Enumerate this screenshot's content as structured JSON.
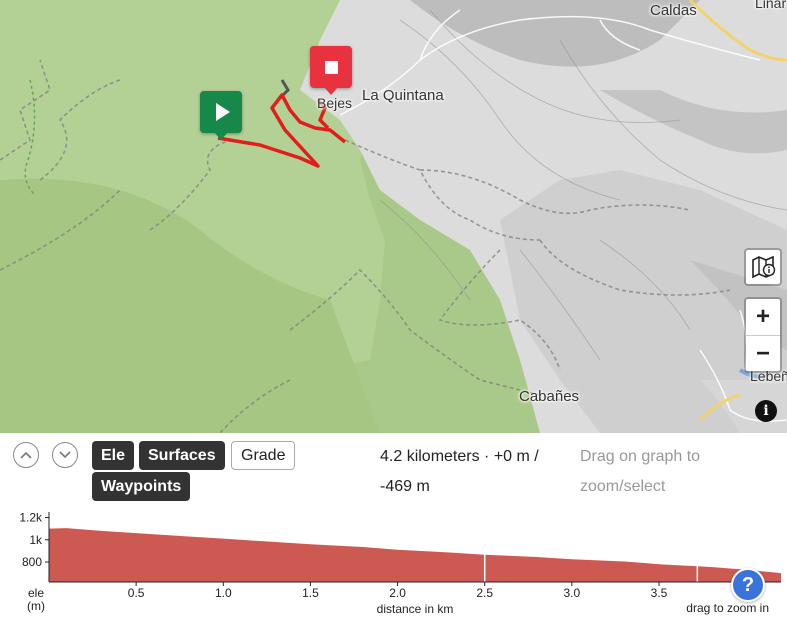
{
  "map": {
    "places": [
      {
        "name": "Caldas"
      },
      {
        "name": "Linar"
      },
      {
        "name": "Bejes"
      },
      {
        "name": "La Quintana"
      },
      {
        "name": "Cabañes"
      },
      {
        "name": "Lebeñ"
      }
    ],
    "markers": {
      "start": "play-icon",
      "end": "stop-icon"
    },
    "controls": {
      "layers_icon": "map-layers-icon",
      "zoom_in": "+",
      "zoom_out": "−",
      "info": "i"
    },
    "colors": {
      "route": "#e01e1e",
      "start": "#16884a",
      "end": "#e8323f"
    }
  },
  "panel": {
    "collapse_up": "︿",
    "collapse_down": "﹀",
    "tabs": [
      {
        "label": "Ele",
        "active": true
      },
      {
        "label": "Surfaces",
        "active": true
      },
      {
        "label": "Grade",
        "active": false
      },
      {
        "label": "Waypoints",
        "active": true
      }
    ],
    "stats": "4.2 kilometers · +0 m / -469 m",
    "hint": "Drag on graph to zoom/select",
    "help": "?"
  },
  "chart_data": {
    "type": "area",
    "ylabel": "ele\n(m)",
    "xlabel": "distance in km",
    "note": "drag to zoom in",
    "y_ticks": [
      "1.2k",
      "1k",
      "800"
    ],
    "y_tick_values": [
      1200,
      1000,
      800
    ],
    "x_ticks": [
      "0.5",
      "1.0",
      "1.5",
      "2.0",
      "2.5",
      "3.0",
      "3.5"
    ],
    "x_tick_values": [
      0.5,
      1.0,
      1.5,
      2.0,
      2.5,
      3.0,
      3.5
    ],
    "xlim": [
      0,
      4.2
    ],
    "ylim": [
      620,
      1250
    ],
    "x": [
      0,
      0.1,
      0.3,
      0.5,
      0.8,
      1.0,
      1.3,
      1.5,
      1.8,
      2.0,
      2.3,
      2.5,
      2.8,
      3.0,
      3.3,
      3.5,
      3.8,
      4.0,
      4.2
    ],
    "y": [
      1100,
      1105,
      1080,
      1060,
      1030,
      1010,
      980,
      960,
      935,
      910,
      885,
      865,
      845,
      825,
      805,
      780,
      755,
      730,
      700
    ],
    "fill_color": "#cd5a52",
    "markers_km": [
      2.5,
      3.72
    ]
  }
}
